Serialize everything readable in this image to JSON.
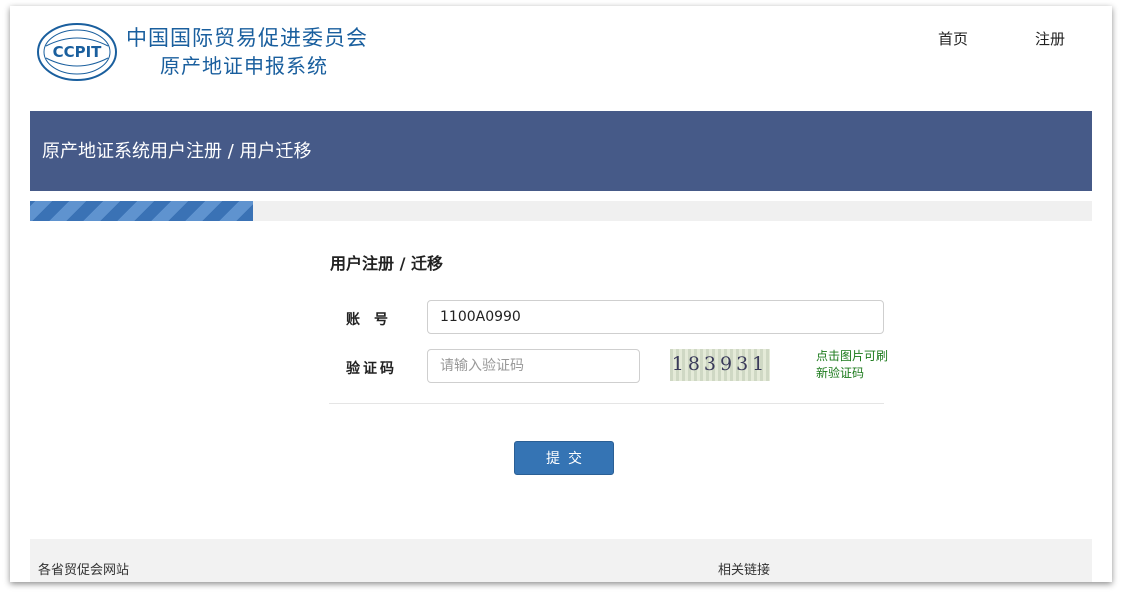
{
  "header": {
    "logo_text": "CCPIT",
    "org_name": "中国国际贸易促进委员会",
    "system_name": "原产地证申报系统",
    "nav": {
      "home": "首页",
      "register": "注册"
    }
  },
  "banner": {
    "title": "原产地证系统用户注册 / 用户迁移"
  },
  "progress": {
    "percent": 21
  },
  "form": {
    "title": "用户注册 / 迁移",
    "account_label": "账号",
    "account_value": "1100A0990",
    "captcha_label": "验证码",
    "captcha_placeholder": "请输入验证码",
    "captcha_code": "183931",
    "captcha_hint": "点击图片可刷新验证码",
    "submit_label": "提交"
  },
  "footer": {
    "left_text": "各省贸促会网站",
    "right_text": "相关链接"
  },
  "colors": {
    "brand_blue": "#1a5f9e",
    "banner_bg": "#465a88",
    "button_bg": "#3574b4",
    "hint_green": "#1b7a1b"
  }
}
